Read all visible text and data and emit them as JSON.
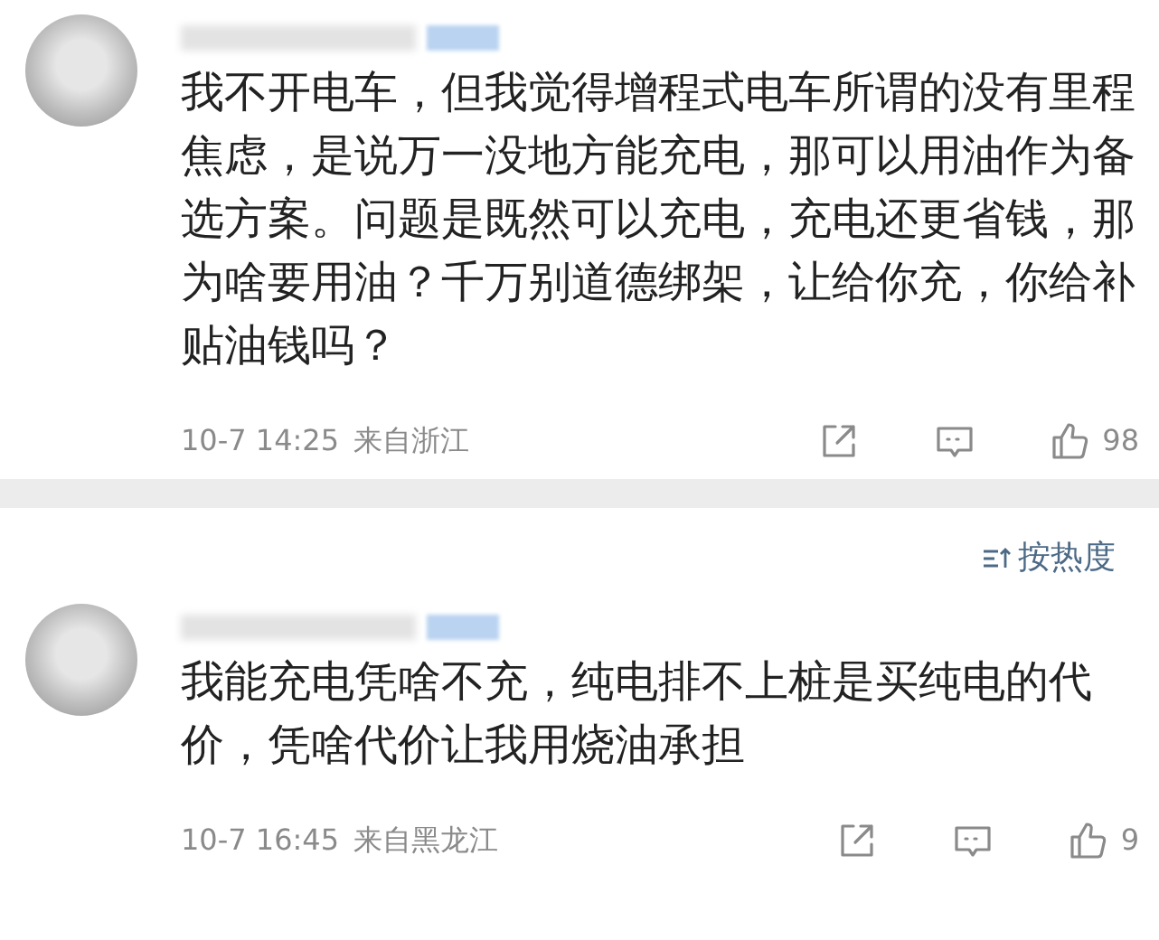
{
  "comments": [
    {
      "text": "我不开电车，但我觉得增程式电车所谓的没有里程焦虑，是说万一没地方能充电，那可以用油作为备选方案。问题是既然可以充电，充电还更省钱，那为啥要用油？千万别道德绑架，让给你充，你给补贴油钱吗？",
      "time": "10-7 14:25",
      "location": "来自浙江",
      "likes": "98"
    },
    {
      "text": "我能充电凭啥不充，纯电排不上桩是买纯电的代价，凭啥代价让我用烧油承担",
      "time": "10-7 16:45",
      "location": "来自黑龙江",
      "likes": "9"
    }
  ],
  "sort": {
    "label": "按热度"
  }
}
